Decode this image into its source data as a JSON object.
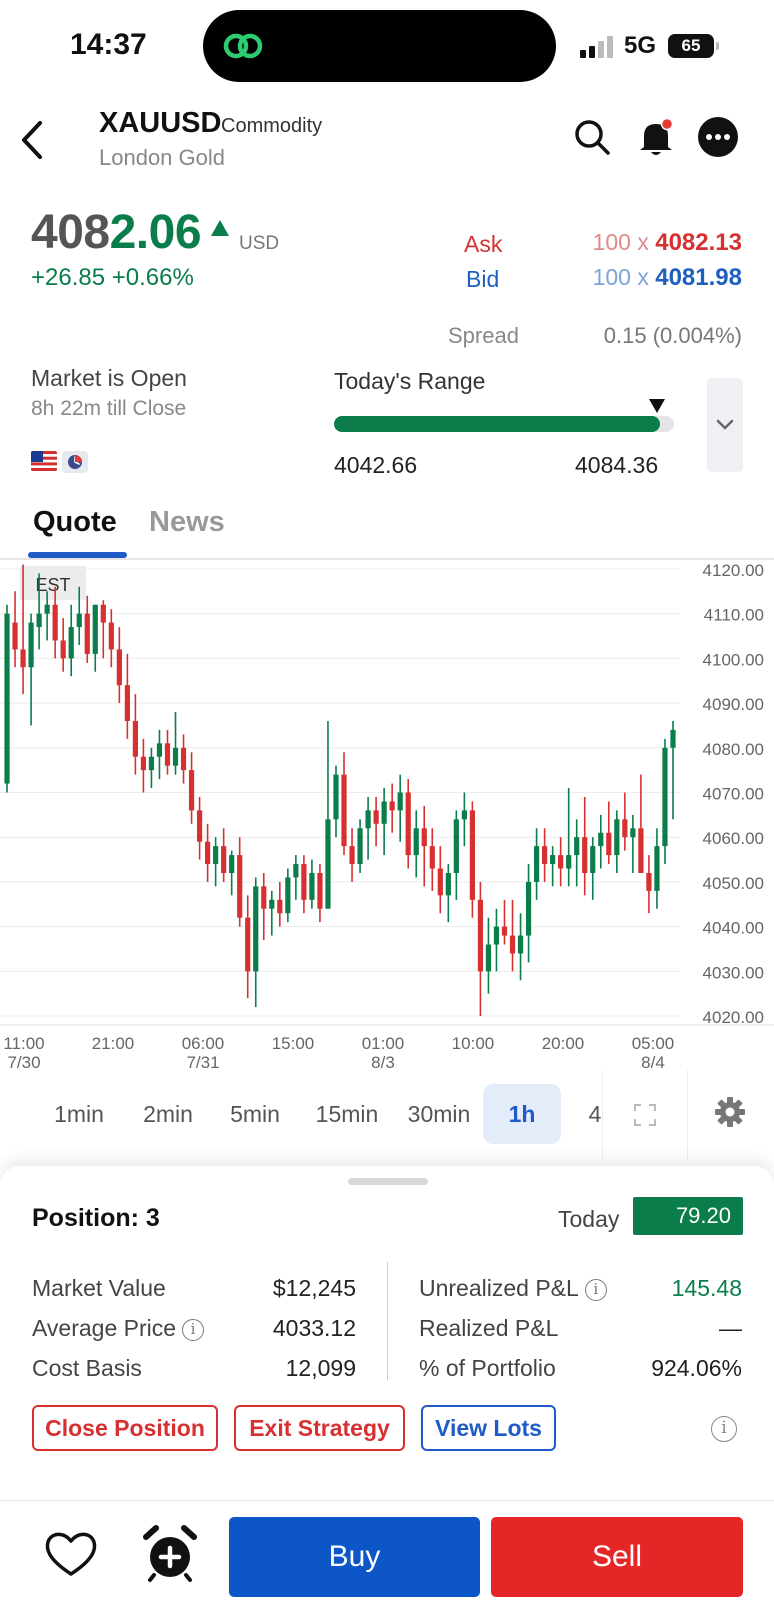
{
  "status_bar": {
    "time": "14:37",
    "network": "5G",
    "battery": "65"
  },
  "header": {
    "symbol": "XAUUSD",
    "asset_type": "Commodity",
    "name": "London Gold"
  },
  "price": {
    "main_prefix": "408",
    "main_suffix": "2.06",
    "currency": "USD",
    "change": "+26.85  +0.66%",
    "ask_label": "Ask",
    "ask_qty": "100 x ",
    "ask_price": "4082.13",
    "bid_label": "Bid",
    "bid_qty": "100 x ",
    "bid_price": "4081.98",
    "spread_label": "Spread",
    "spread_value": "0.15 (0.004%)"
  },
  "market": {
    "status": "Market is Open",
    "till_close": "8h 22m till Close",
    "range_title": "Today's Range",
    "range_low": "4042.66",
    "range_high": "4084.36",
    "range_position": 0.95,
    "range_fill": 0.96
  },
  "tabs": [
    {
      "label": "Quote"
    },
    {
      "label": "News"
    }
  ],
  "chart_data": {
    "type": "candlestick",
    "timezone_label": "EST",
    "y_ticks": [
      "4120.00",
      "4110.00",
      "4100.00",
      "4090.00",
      "4080.00",
      "4070.00",
      "4060.00",
      "4050.00",
      "4040.00",
      "4030.00",
      "4020.00"
    ],
    "ylim": [
      4018,
      4122
    ],
    "x_ticks": [
      {
        "time": "11:00",
        "date": "7/30"
      },
      {
        "time": "21:00",
        "date": ""
      },
      {
        "time": "06:00",
        "date": "7/31"
      },
      {
        "time": "15:00",
        "date": ""
      },
      {
        "time": "01:00",
        "date": "8/3"
      },
      {
        "time": "10:00",
        "date": ""
      },
      {
        "time": "20:00",
        "date": ""
      },
      {
        "time": "05:00",
        "date": "8/4"
      }
    ],
    "candles": [
      [
        4072,
        4112,
        4070,
        4110
      ],
      [
        4108,
        4115,
        4098,
        4102
      ],
      [
        4102,
        4121,
        4092,
        4098
      ],
      [
        4098,
        4110,
        4085,
        4108
      ],
      [
        4107,
        4119,
        4102,
        4110
      ],
      [
        4110,
        4115,
        4104,
        4112
      ],
      [
        4112,
        4116,
        4100,
        4104
      ],
      [
        4104,
        4109,
        4097,
        4100
      ],
      [
        4100,
        4112,
        4096,
        4107
      ],
      [
        4107,
        4116,
        4103,
        4110
      ],
      [
        4110,
        4114,
        4099,
        4101
      ],
      [
        4101,
        4108,
        4097,
        4112
      ],
      [
        4112,
        4113,
        4100,
        4108
      ],
      [
        4108,
        4111,
        4098,
        4102
      ],
      [
        4102,
        4107,
        4090,
        4094
      ],
      [
        4094,
        4101,
        4082,
        4086
      ],
      [
        4086,
        4092,
        4074,
        4078
      ],
      [
        4078,
        4082,
        4070,
        4075
      ],
      [
        4075,
        4080,
        4071,
        4078
      ],
      [
        4078,
        4084,
        4073,
        4081
      ],
      [
        4081,
        4084,
        4074,
        4076
      ],
      [
        4076,
        4088,
        4074,
        4080
      ],
      [
        4080,
        4083,
        4072,
        4075
      ],
      [
        4075,
        4079,
        4063,
        4066
      ],
      [
        4066,
        4069,
        4055,
        4059
      ],
      [
        4059,
        4063,
        4050,
        4054
      ],
      [
        4054,
        4060,
        4049,
        4058
      ],
      [
        4058,
        4062,
        4050,
        4052
      ],
      [
        4052,
        4057,
        4047,
        4056
      ],
      [
        4056,
        4060,
        4040,
        4042
      ],
      [
        4042,
        4047,
        4024,
        4030
      ],
      [
        4030,
        4051,
        4022,
        4049
      ],
      [
        4049,
        4052,
        4037,
        4044
      ],
      [
        4044,
        4048,
        4038,
        4046
      ],
      [
        4046,
        4050,
        4040,
        4043
      ],
      [
        4043,
        4053,
        4041,
        4051
      ],
      [
        4051,
        4056,
        4046,
        4054
      ],
      [
        4054,
        4056,
        4043,
        4046
      ],
      [
        4046,
        4055,
        4044,
        4052
      ],
      [
        4052,
        4054,
        4041,
        4044
      ],
      [
        4044,
        4086,
        4050,
        4064
      ],
      [
        4064,
        4076,
        4060,
        4074
      ],
      [
        4074,
        4079,
        4056,
        4058
      ],
      [
        4058,
        4062,
        4050,
        4054
      ],
      [
        4054,
        4064,
        4052,
        4062
      ],
      [
        4062,
        4069,
        4055,
        4066
      ],
      [
        4066,
        4069,
        4058,
        4063
      ],
      [
        4063,
        4071,
        4056,
        4068
      ],
      [
        4068,
        4072,
        4061,
        4066
      ],
      [
        4066,
        4074,
        4059,
        4070
      ],
      [
        4070,
        4073,
        4053,
        4056
      ],
      [
        4056,
        4066,
        4051,
        4062
      ],
      [
        4062,
        4067,
        4049,
        4058
      ],
      [
        4058,
        4062,
        4048,
        4053
      ],
      [
        4053,
        4058,
        4043,
        4047
      ],
      [
        4047,
        4054,
        4041,
        4052
      ],
      [
        4052,
        4066,
        4046,
        4064
      ],
      [
        4064,
        4070,
        4058,
        4066
      ],
      [
        4066,
        4068,
        4042,
        4046
      ],
      [
        4046,
        4050,
        4020,
        4030
      ],
      [
        4030,
        4042,
        4025,
        4036
      ],
      [
        4036,
        4044,
        4030,
        4040
      ],
      [
        4040,
        4046,
        4036,
        4038
      ],
      [
        4038,
        4046,
        4030,
        4034
      ],
      [
        4034,
        4043,
        4028,
        4038
      ],
      [
        4038,
        4054,
        4032,
        4050
      ],
      [
        4050,
        4062,
        4046,
        4058
      ],
      [
        4058,
        4062,
        4050,
        4054
      ],
      [
        4054,
        4058,
        4049,
        4056
      ],
      [
        4056,
        4060,
        4049,
        4053
      ],
      [
        4053,
        4071,
        4049,
        4056
      ],
      [
        4056,
        4064,
        4049,
        4060
      ],
      [
        4060,
        4069,
        4047,
        4052
      ],
      [
        4052,
        4060,
        4046,
        4058
      ],
      [
        4058,
        4065,
        4053,
        4061
      ],
      [
        4061,
        4068,
        4054,
        4056
      ],
      [
        4056,
        4066,
        4052,
        4064
      ],
      [
        4064,
        4070,
        4057,
        4060
      ],
      [
        4060,
        4065,
        4052,
        4062
      ],
      [
        4062,
        4074,
        4056,
        4052
      ],
      [
        4052,
        4056,
        4043,
        4048
      ],
      [
        4048,
        4062,
        4044,
        4058
      ],
      [
        4058,
        4082,
        4054,
        4080
      ],
      [
        4080,
        4086,
        4064,
        4084
      ]
    ]
  },
  "intervals": [
    {
      "label": "1min",
      "active": false
    },
    {
      "label": "2min",
      "active": false
    },
    {
      "label": "5min",
      "active": false
    },
    {
      "label": "15min",
      "active": false
    },
    {
      "label": "30min",
      "active": false
    },
    {
      "label": "1h",
      "active": true
    },
    {
      "label": "4",
      "active": false
    }
  ],
  "position": {
    "title": "Position: 3",
    "today_label": "Today",
    "today_value": "79.20",
    "market_value_label": "Market Value",
    "market_value": "$12,245",
    "avg_price_label": "Average Price",
    "avg_price": "4033.12",
    "cost_basis_label": "Cost Basis",
    "cost_basis": "12,099",
    "unrealized_label": "Unrealized P&L",
    "unrealized": "145.48",
    "realized_label": "Realized P&L",
    "realized": "—",
    "portfolio_label": "% of Portfolio",
    "portfolio": "924.06%",
    "close_position": "Close Position",
    "exit_strategy": "Exit Strategy",
    "view_lots": "View Lots"
  },
  "bottom": {
    "buy": "Buy",
    "sell": "Sell"
  },
  "colors": {
    "up": "#0a7d4a",
    "down": "#d63031",
    "accent": "#1e5bc6",
    "buy": "#0d56c8",
    "sell": "#e42626"
  }
}
